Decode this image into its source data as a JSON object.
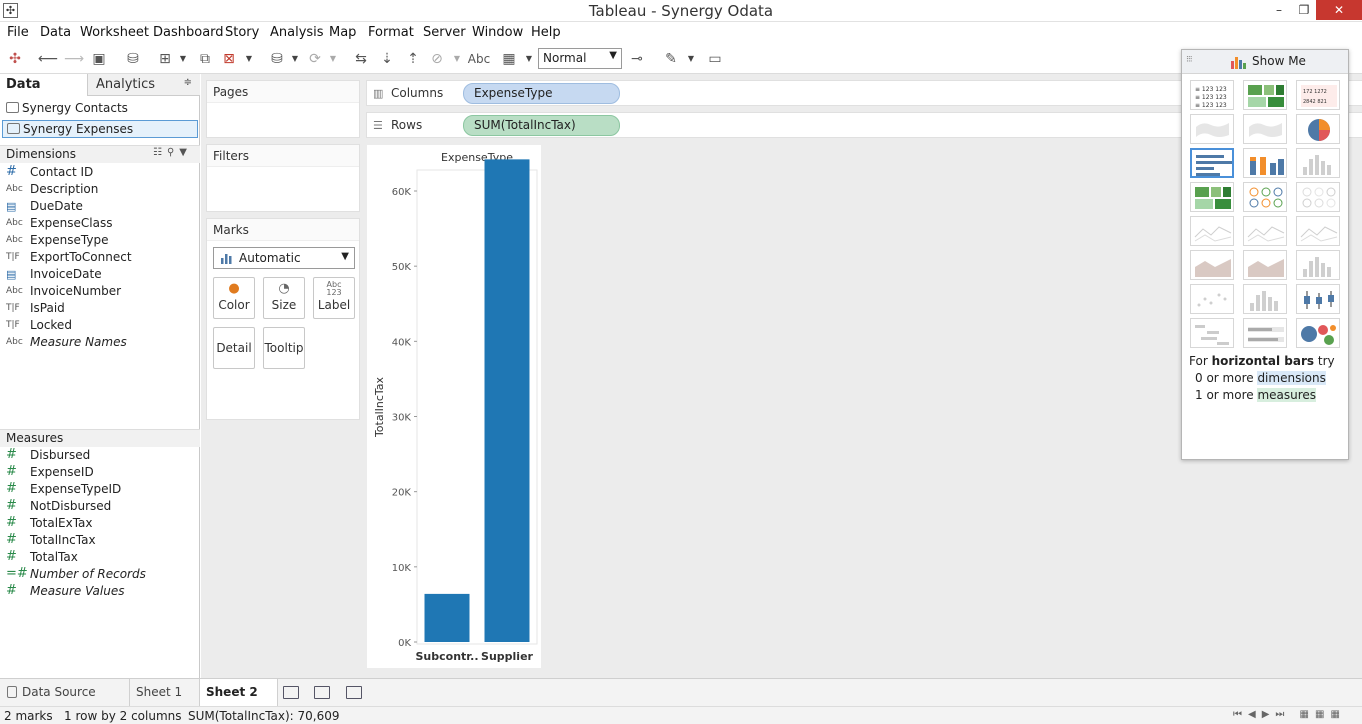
{
  "window": {
    "title": "Tableau - Synergy Odata",
    "min": "–",
    "max": "❐",
    "close": "✕"
  },
  "menu": [
    "File",
    "Data",
    "Worksheet",
    "Dashboard",
    "Story",
    "Analysis",
    "Map",
    "Format",
    "Server",
    "Window",
    "Help"
  ],
  "toolbar": {
    "fit": "Normal",
    "abc": "Abc"
  },
  "left_pane": {
    "tab_data": "Data",
    "tab_analytics": "Analytics",
    "datasources": [
      "Synergy Contacts",
      "Synergy Expenses"
    ],
    "dimensions_label": "Dimensions",
    "dimensions": [
      {
        "type": "#",
        "name": "Contact ID"
      },
      {
        "type": "Abc",
        "name": "Description"
      },
      {
        "type": "date",
        "name": "DueDate"
      },
      {
        "type": "Abc",
        "name": "ExpenseClass"
      },
      {
        "type": "Abc",
        "name": "ExpenseType"
      },
      {
        "type": "T|F",
        "name": "ExportToConnect"
      },
      {
        "type": "date",
        "name": "InvoiceDate"
      },
      {
        "type": "Abc",
        "name": "InvoiceNumber"
      },
      {
        "type": "T|F",
        "name": "IsPaid"
      },
      {
        "type": "T|F",
        "name": "Locked"
      },
      {
        "type": "Abc",
        "name": "Measure Names"
      }
    ],
    "measures_label": "Measures",
    "measures": [
      {
        "type": "#",
        "name": "Disbursed"
      },
      {
        "type": "#",
        "name": "ExpenseID"
      },
      {
        "type": "#",
        "name": "ExpenseTypeID"
      },
      {
        "type": "#",
        "name": "NotDisbursed"
      },
      {
        "type": "#",
        "name": "TotalExTax"
      },
      {
        "type": "#",
        "name": "TotalIncTax"
      },
      {
        "type": "#",
        "name": "TotalTax"
      },
      {
        "type": "=#",
        "name": "Number of Records"
      },
      {
        "type": "#",
        "name": "Measure Values"
      }
    ]
  },
  "cards": {
    "pages": "Pages",
    "filters": "Filters",
    "marks": "Marks",
    "mark_type": "Automatic",
    "color": "Color",
    "size": "Size",
    "label": "Label",
    "label_glyph": "Abc 123",
    "detail": "Detail",
    "tooltip": "Tooltip"
  },
  "shelves": {
    "columns_label": "Columns",
    "columns_pill": "ExpenseType",
    "rows_label": "Rows",
    "rows_pill": "SUM(TotalIncTax)"
  },
  "chart_data": {
    "type": "bar",
    "title": "ExpenseType",
    "ylabel": "TotalIncTax",
    "categories": [
      "Subcontr..",
      "Supplier"
    ],
    "values": [
      6400,
      64209
    ],
    "ylim": [
      0,
      64000
    ],
    "yticks": [
      "0K",
      "10K",
      "20K",
      "30K",
      "40K",
      "50K",
      "60K"
    ],
    "bar_color": "#1f77b4",
    "grid": false
  },
  "showme": {
    "title": "Show Me",
    "hint_prefix": "For ",
    "hint_bold": "horizontal bars",
    "hint_suffix": " try",
    "req1_prefix": "0 or more ",
    "req1_hl": "dimensions",
    "req2_prefix": "1 or more ",
    "req2_hl": "measures"
  },
  "tabs": {
    "data_source": "Data Source",
    "sheet1": "Sheet 1",
    "sheet2": "Sheet 2"
  },
  "status": {
    "marks": "2 marks",
    "dims": "1 row by 2 columns",
    "sum": "SUM(TotalIncTax): 70,609"
  }
}
